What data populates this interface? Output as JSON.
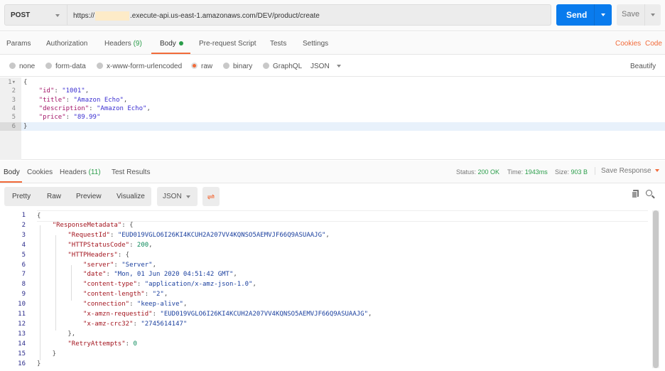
{
  "request": {
    "method": "POST",
    "url_prefix": "https://",
    "url_suffix": ".execute-api.us-east-1.amazonaws.com/DEV/product/create",
    "send_label": "Send",
    "save_label": "Save"
  },
  "tabs": {
    "params": "Params",
    "authorization": "Authorization",
    "headers": "Headers",
    "headers_count": "(9)",
    "body": "Body",
    "prerequest": "Pre-request Script",
    "tests": "Tests",
    "settings": "Settings",
    "cookies": "Cookies",
    "code": "Code"
  },
  "body_types": {
    "none": "none",
    "form_data": "form-data",
    "urlencoded": "x-www-form-urlencoded",
    "raw": "raw",
    "binary": "binary",
    "graphql": "GraphQL",
    "format": "JSON",
    "beautify": "Beautify"
  },
  "request_body": [
    {
      "n": "1▾",
      "t": [
        [
          "p",
          "{"
        ]
      ]
    },
    {
      "n": "2",
      "t": [
        [
          "p",
          "    "
        ],
        [
          "k",
          "\"id\""
        ],
        [
          "p",
          ": "
        ],
        [
          "v",
          "\"1001\""
        ],
        [
          "p",
          ","
        ]
      ]
    },
    {
      "n": "3",
      "t": [
        [
          "p",
          "    "
        ],
        [
          "k",
          "\"title\""
        ],
        [
          "p",
          ": "
        ],
        [
          "v",
          "\"Amazon Echo\""
        ],
        [
          "p",
          ","
        ]
      ]
    },
    {
      "n": "4",
      "t": [
        [
          "p",
          "    "
        ],
        [
          "k",
          "\"description\""
        ],
        [
          "p",
          ": "
        ],
        [
          "v",
          "\"Amazon Echo\""
        ],
        [
          "p",
          ","
        ]
      ]
    },
    {
      "n": "5",
      "t": [
        [
          "p",
          "    "
        ],
        [
          "k",
          "\"price\""
        ],
        [
          "p",
          ": "
        ],
        [
          "v",
          "\"89.99\""
        ]
      ]
    },
    {
      "n": "6",
      "t": [
        [
          "p",
          "}"
        ]
      ]
    }
  ],
  "response_tabs": {
    "body": "Body",
    "cookies": "Cookies",
    "headers": "Headers",
    "headers_count": "(11)",
    "test_results": "Test Results"
  },
  "status": {
    "status_label": "Status:",
    "status": "200 OK",
    "time_label": "Time:",
    "time": "1943ms",
    "size_label": "Size:",
    "size": "903 B",
    "save_response": "Save Response"
  },
  "view": {
    "pretty": "Pretty",
    "raw": "Raw",
    "preview": "Preview",
    "visualize": "Visualize",
    "format": "JSON"
  },
  "response_body": [
    {
      "n": "1",
      "t": [
        [
          "p",
          "{"
        ]
      ]
    },
    {
      "n": "2",
      "t": [
        [
          "p",
          "    "
        ],
        [
          "k",
          "\"ResponseMetadata\""
        ],
        [
          "p",
          ": {"
        ]
      ]
    },
    {
      "n": "3",
      "t": [
        [
          "p",
          "        "
        ],
        [
          "k",
          "\"RequestId\""
        ],
        [
          "p",
          ": "
        ],
        [
          "v",
          "\"EUD019VGLO6I26KI4KCUH2A207VV4KQNSO5AEMVJF66Q9ASUAAJG\""
        ],
        [
          "p",
          ","
        ]
      ]
    },
    {
      "n": "4",
      "t": [
        [
          "p",
          "        "
        ],
        [
          "k",
          "\"HTTPStatusCode\""
        ],
        [
          "p",
          ": "
        ],
        [
          "num",
          "200"
        ],
        [
          "p",
          ","
        ]
      ]
    },
    {
      "n": "5",
      "t": [
        [
          "p",
          "        "
        ],
        [
          "k",
          "\"HTTPHeaders\""
        ],
        [
          "p",
          ": {"
        ]
      ]
    },
    {
      "n": "6",
      "t": [
        [
          "p",
          "            "
        ],
        [
          "k",
          "\"server\""
        ],
        [
          "p",
          ": "
        ],
        [
          "v",
          "\"Server\""
        ],
        [
          "p",
          ","
        ]
      ]
    },
    {
      "n": "7",
      "t": [
        [
          "p",
          "            "
        ],
        [
          "k",
          "\"date\""
        ],
        [
          "p",
          ": "
        ],
        [
          "v",
          "\"Mon, 01 Jun 2020 04:51:42 GMT\""
        ],
        [
          "p",
          ","
        ]
      ]
    },
    {
      "n": "8",
      "t": [
        [
          "p",
          "            "
        ],
        [
          "k",
          "\"content-type\""
        ],
        [
          "p",
          ": "
        ],
        [
          "v",
          "\"application/x-amz-json-1.0\""
        ],
        [
          "p",
          ","
        ]
      ]
    },
    {
      "n": "9",
      "t": [
        [
          "p",
          "            "
        ],
        [
          "k",
          "\"content-length\""
        ],
        [
          "p",
          ": "
        ],
        [
          "v",
          "\"2\""
        ],
        [
          "p",
          ","
        ]
      ]
    },
    {
      "n": "10",
      "t": [
        [
          "p",
          "            "
        ],
        [
          "k",
          "\"connection\""
        ],
        [
          "p",
          ": "
        ],
        [
          "v",
          "\"keep-alive\""
        ],
        [
          "p",
          ","
        ]
      ]
    },
    {
      "n": "11",
      "t": [
        [
          "p",
          "            "
        ],
        [
          "k",
          "\"x-amzn-requestid\""
        ],
        [
          "p",
          ": "
        ],
        [
          "v",
          "\"EUD019VGLO6I26KI4KCUH2A207VV4KQNSO5AEMVJF66Q9ASUAAJG\""
        ],
        [
          "p",
          ","
        ]
      ]
    },
    {
      "n": "12",
      "t": [
        [
          "p",
          "            "
        ],
        [
          "k",
          "\"x-amz-crc32\""
        ],
        [
          "p",
          ": "
        ],
        [
          "v",
          "\"2745614147\""
        ]
      ]
    },
    {
      "n": "13",
      "t": [
        [
          "p",
          "        },"
        ]
      ]
    },
    {
      "n": "14",
      "t": [
        [
          "p",
          "        "
        ],
        [
          "k",
          "\"RetryAttempts\""
        ],
        [
          "p",
          ": "
        ],
        [
          "num",
          "0"
        ]
      ]
    },
    {
      "n": "15",
      "t": [
        [
          "p",
          "    }"
        ]
      ]
    },
    {
      "n": "16",
      "t": [
        [
          "p",
          "}"
        ]
      ]
    }
  ],
  "colors": {
    "accent": "#f26b3a",
    "send": "#097bed",
    "success": "#2a9d4a"
  }
}
